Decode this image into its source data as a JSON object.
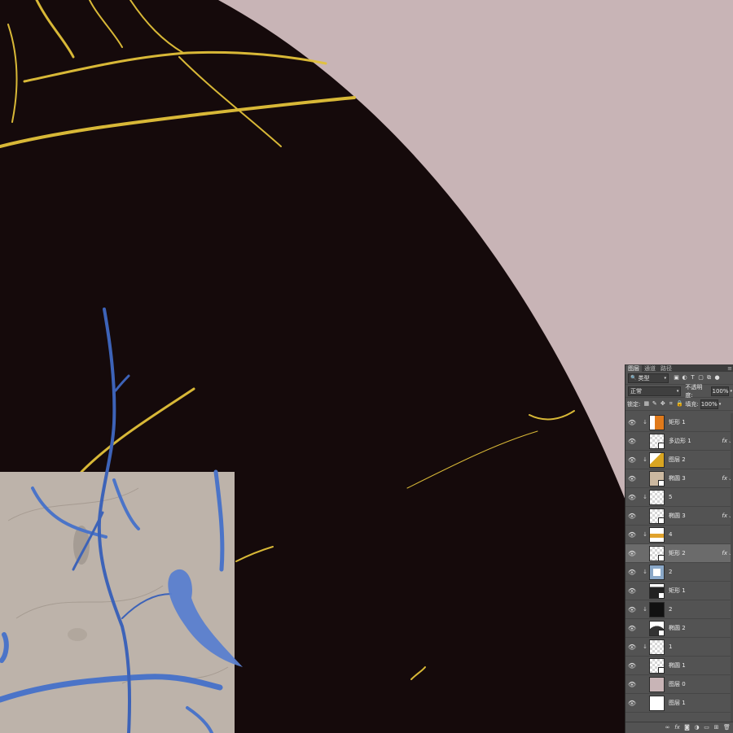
{
  "panel": {
    "tabs": [
      {
        "label": "图层"
      },
      {
        "label": "通道"
      },
      {
        "label": "路径"
      }
    ],
    "filter_kind": "类型",
    "blend_mode": "正常",
    "opacity_label": "不透明度:",
    "opacity_value": "100%",
    "lock_label": "锁定:",
    "fill_label": "填充:",
    "fill_value": "100%",
    "footer_icons": [
      "link-icon",
      "fx-icon",
      "mask-icon",
      "adjustment-icon",
      "group-icon",
      "new-layer-icon",
      "trash-icon"
    ]
  },
  "layers": [
    {
      "name": "矩形 1",
      "clipped": true,
      "fx": false,
      "thumb": "orange-white",
      "selected": false
    },
    {
      "name": "多边形 1",
      "clipped": false,
      "fx": true,
      "thumb": "checker-mask",
      "selected": false
    },
    {
      "name": "图层 2",
      "clipped": true,
      "fx": false,
      "thumb": "gold",
      "selected": false
    },
    {
      "name": "椭圆 3",
      "clipped": false,
      "fx": true,
      "thumb": "marble-mask",
      "selected": false
    },
    {
      "name": "5",
      "clipped": true,
      "fx": false,
      "thumb": "checker-blob",
      "selected": false
    },
    {
      "name": "椭圆 3",
      "clipped": false,
      "fx": true,
      "thumb": "checker-mask",
      "selected": false
    },
    {
      "name": "4",
      "clipped": true,
      "fx": false,
      "thumb": "gold-strip",
      "selected": false
    },
    {
      "name": "矩形 2",
      "clipped": false,
      "fx": true,
      "thumb": "checker-mask",
      "selected": true
    },
    {
      "name": "2",
      "clipped": true,
      "fx": false,
      "thumb": "blue-frame",
      "selected": false
    },
    {
      "name": "矩形 1",
      "clipped": false,
      "fx": false,
      "thumb": "dark-mask",
      "selected": false
    },
    {
      "name": "2",
      "clipped": true,
      "fx": false,
      "thumb": "black",
      "selected": false
    },
    {
      "name": "椭圆 2",
      "clipped": false,
      "fx": false,
      "thumb": "dome",
      "selected": false
    },
    {
      "name": "1",
      "clipped": true,
      "fx": false,
      "thumb": "checker",
      "selected": false
    },
    {
      "name": "椭圆 1",
      "clipped": false,
      "fx": false,
      "thumb": "checker-mask",
      "selected": false
    },
    {
      "name": "图层 0",
      "clipped": false,
      "fx": false,
      "thumb": "pink",
      "selected": false
    },
    {
      "name": "图层 1",
      "clipped": false,
      "fx": false,
      "thumb": "white",
      "selected": false
    }
  ],
  "colors": {
    "background": "#c8b4b6",
    "dark_shape": "#150a0b",
    "gold": "#e3c23a",
    "marble": "#bdb3aa",
    "blue": "#3d63b8"
  }
}
